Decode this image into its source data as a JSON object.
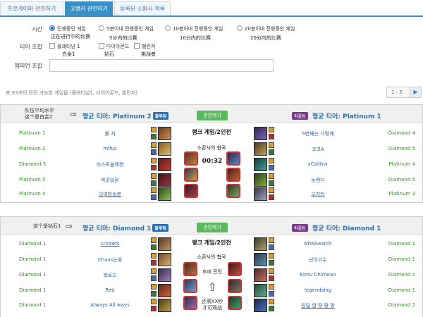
{
  "tabs": [
    {
      "label": "프로게이머 관전하기",
      "active": false
    },
    {
      "label": "고랭커 관전하기",
      "active": true
    },
    {
      "label": "등록된 소환사 목록",
      "active": false
    }
  ],
  "filter": {
    "time_label": "시간",
    "time_options": [
      {
        "label": "진행중인 게임",
        "sub": "正在进行中的比赛",
        "selected": true
      },
      {
        "label": "5분이내 진행중인 게임",
        "sub": "5分内的比赛",
        "selected": false
      },
      {
        "label": "10분이내 진행중인 게임",
        "sub": "10分内的比赛",
        "selected": false
      },
      {
        "label": "20분이내 진행중인 게임",
        "sub": "20分内的比赛",
        "selected": false
      }
    ],
    "tier_label": "티어 조합",
    "tier_options": [
      {
        "label": "플래티넘 1",
        "sub": "白金1"
      },
      {
        "label": "다이아몬드",
        "sub": "钻石"
      },
      {
        "label": "챌린저",
        "sub": "挑战者"
      }
    ],
    "champ_label": "챔피언 조합",
    "champ_value": ""
  },
  "info_text": "총 93개의 관전 가능한 게임들 (플래티넘1, 다이아몬드, 챌린저)",
  "pager": {
    "text": "1 - 5",
    "next": "▶"
  },
  "matches": [
    {
      "note": "队伍平均水平\n这个是白金2",
      "blue_avg": "평균 티어: Platinum 2",
      "blue_badge": "블루팀",
      "watch": "관전하기",
      "purple_badge": "퍼플팀",
      "purple_avg": "평균 티어: Platinum 1",
      "center_title": "랭크 게임/2인전",
      "center_map": "소환사의 협곡",
      "timer": "00:32",
      "rows": [
        {
          "tier_l": "Platinum 1",
          "name_l": "롤 지",
          "name_r": "5변째는 너랑쾌",
          "tier_r": "Diamond 4",
          "ul_l": false,
          "ul_r": false
        },
        {
          "tier_l": "Platinum 2",
          "name_l": "mlfus",
          "name_r": "코코A",
          "tier_r": "Diamond 5",
          "ul_l": false,
          "ul_r": false
        },
        {
          "tier_l": "Diamond 5",
          "name_l": "미스토블랙켓",
          "name_r": "xCalibvr",
          "tier_r": "Platinum 4",
          "ul_l": false,
          "ul_r": false
        },
        {
          "tier_l": "Platinum 5",
          "name_l": "박쿵일몬",
          "name_r": "농켄다",
          "tier_r": "Diamond 5",
          "ul_l": false,
          "ul_r": false
        },
        {
          "tier_l": "Platinum 4",
          "name_l": "잉여방송분",
          "name_r": "오지터",
          "tier_r": "Platinum 3",
          "ul_l": true,
          "ul_r": true
        }
      ]
    },
    {
      "note": "这个是钻石1",
      "blue_avg": "평균 티어: Diamond 1",
      "blue_badge": "블루팀",
      "watch": "관전하기",
      "purple_badge": "퍼플팀",
      "purple_avg": "평균 티어: Diamond 1",
      "center_title": "랭크 게임/2인전",
      "center_map": "소환사의 협곡",
      "delay_top": "후에 관전",
      "delay_bottom": "还需XX秒\n才可观战",
      "rows": [
        {
          "tier_l": "Diamond 1",
          "name_l": "crickets",
          "name_r": "NhNSearch",
          "tier_r": "Diamond 1",
          "ul_l": true,
          "ul_r": false
        },
        {
          "tier_l": "Diamond 1",
          "name_l": "Chaos눈꽃",
          "name_r": "난이고수",
          "tier_r": "Diamond 1",
          "ul_l": false,
          "ul_r": false
        },
        {
          "tier_l": "Diamond 1",
          "name_l": "북로드",
          "name_r": "Kimu Chimean",
          "tier_r": "Diamond 1",
          "ul_l": false,
          "ul_r": false
        },
        {
          "tier_l": "Diamond 1",
          "name_l": "Red",
          "name_r": "legendsing",
          "tier_r": "Diamond 1",
          "ul_l": false,
          "ul_r": false
        },
        {
          "tier_l": "Diamond 1",
          "name_l": "Always All ways",
          "name_r": "원딜 할 땅 팡 팡",
          "tier_r": "Diamond 2",
          "ul_l": false,
          "ul_r": true
        }
      ]
    }
  ],
  "colors": {
    "accent": "#3a8fc6",
    "blue_text": "#2a6fb0",
    "tier_green": "#3a8a2a",
    "purple_badge": "#7a3a8a",
    "watch_green": "#5cb85c"
  }
}
